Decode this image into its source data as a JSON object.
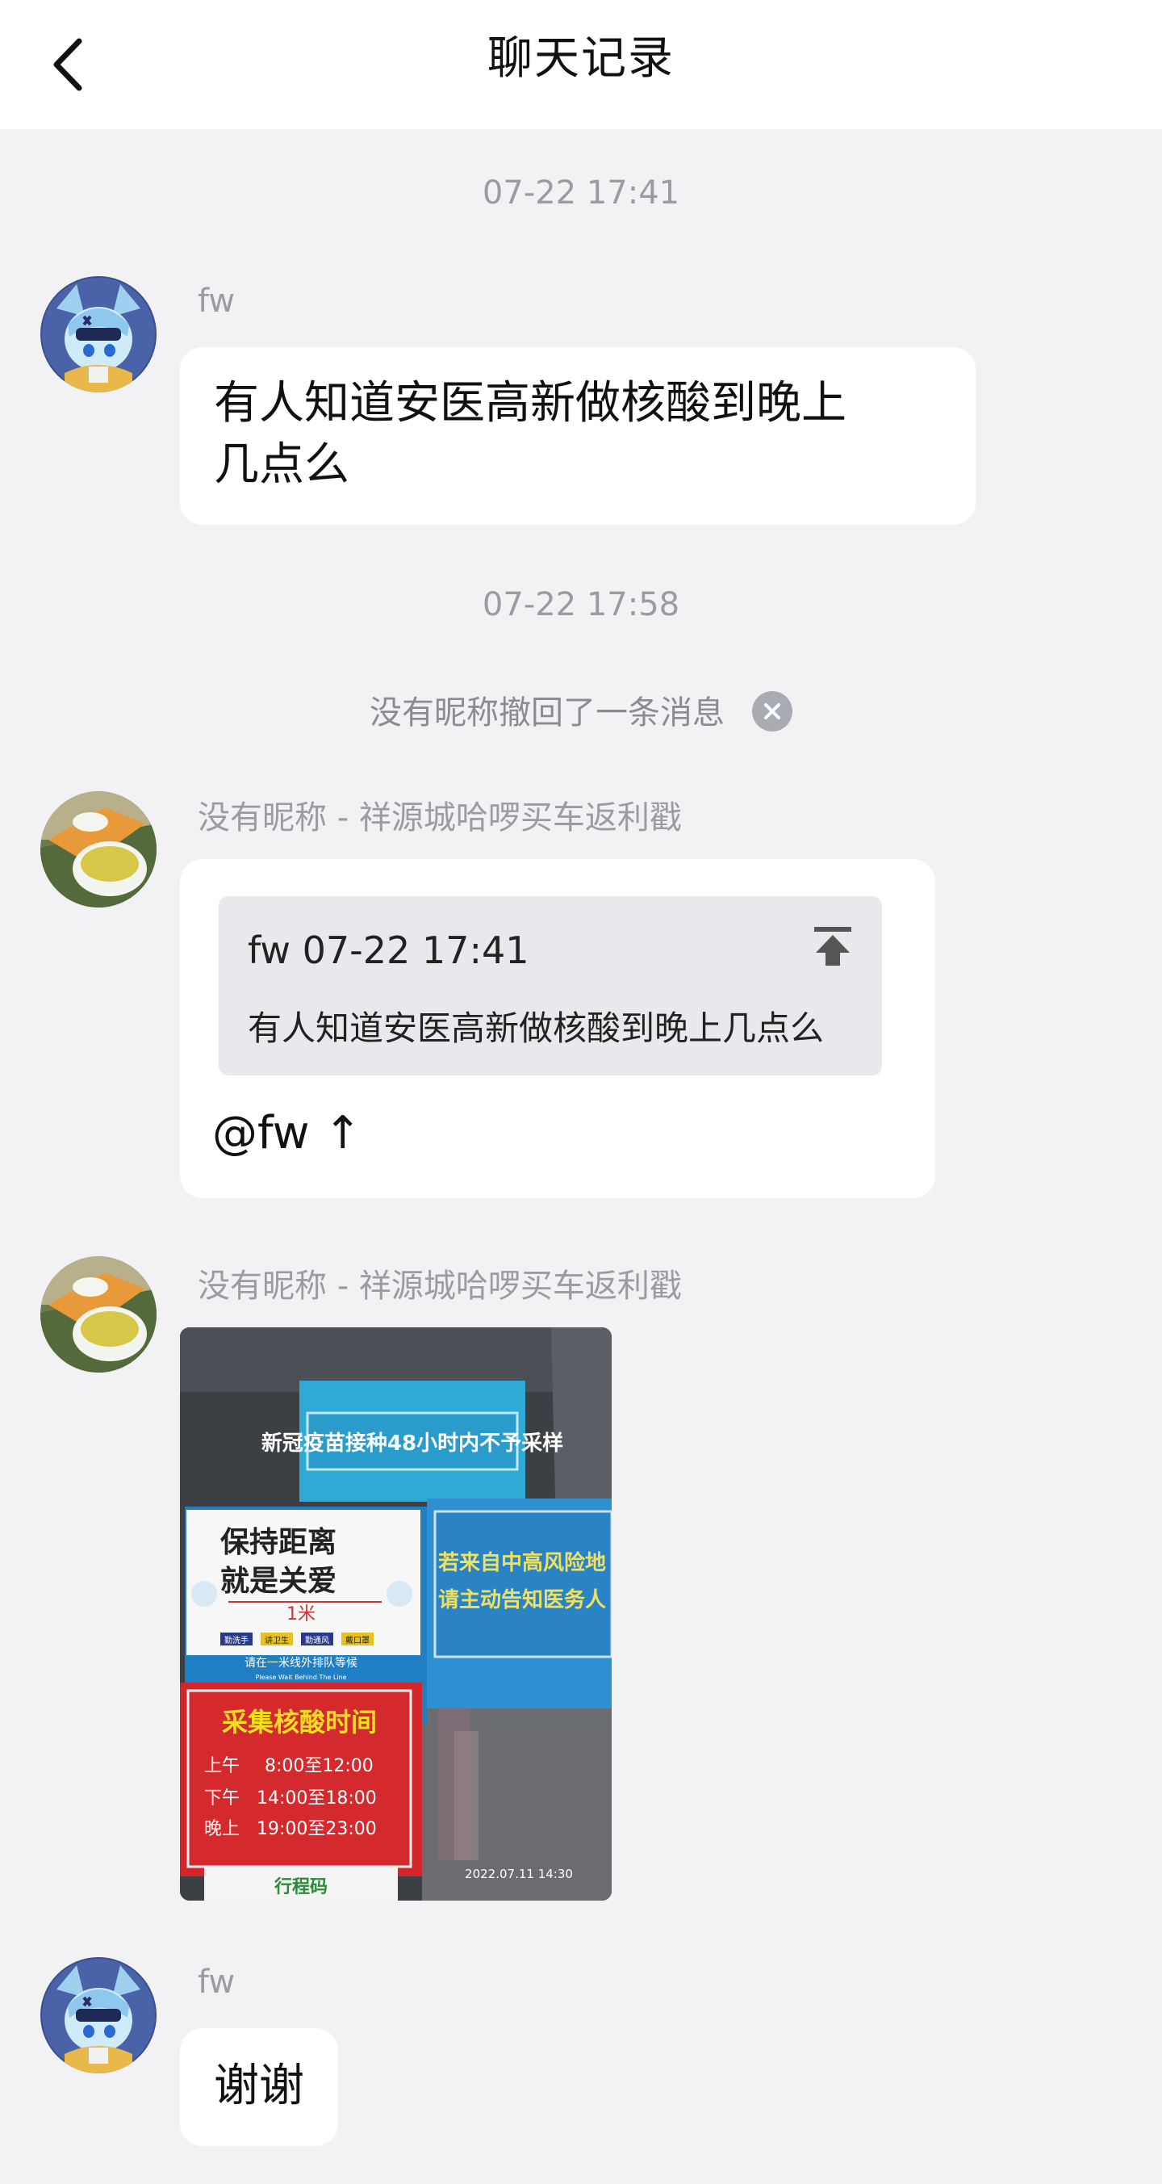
{
  "header": {
    "title": "聊天记录",
    "back_icon": "chevron-left-icon"
  },
  "messages": {
    "ts1": "07-22 17:41",
    "msg1": {
      "sender": "fw",
      "text_line1": "有人知道安医高新做核酸到晚上",
      "text_line2": "几点么"
    },
    "ts2": "07-22 17:58",
    "recall": {
      "text": "没有昵称撤回了一条消息",
      "icon": "close-circle-icon"
    },
    "msg2": {
      "sender": "没有昵称 - 祥源城哈啰买车返利戳",
      "quote_meta": "fw 07-22 17:41",
      "quote_text": "有人知道安医高新做核酸到晚上几点么",
      "quote_icon": "jump-to-top-icon",
      "text": "@fw ↑"
    },
    "msg3": {
      "sender": "没有昵称 - 祥源城哈啰买车返利戳",
      "photo": {
        "sign_top": "新冠疫苗接种48小时内不予采样",
        "sign_left_line1": "保持距离",
        "sign_left_line2": "就是关爱",
        "sign_left_distance": "1米",
        "sign_left_tags": [
          "勤洗手",
          "讲卫生",
          "勤通风",
          "戴口罩"
        ],
        "sign_left_queue": "请在一米线外排队等候",
        "sign_left_queue_en": "Please Wait Behind The Line",
        "sign_right_line1": "若来自中高风险地",
        "sign_right_line2": "请主动告知医务人",
        "hours_title": "采集核酸时间",
        "hours": [
          {
            "label": "上午",
            "time": "8:00至12:00"
          },
          {
            "label": "下午",
            "time": "14:00至18:00"
          },
          {
            "label": "晚上",
            "time": "19:00至23:00"
          }
        ],
        "bottom_sign": "行程码",
        "photo_timestamp": "2022.07.11  14:30"
      }
    },
    "msg4": {
      "sender": "fw",
      "text": "谢谢"
    }
  }
}
